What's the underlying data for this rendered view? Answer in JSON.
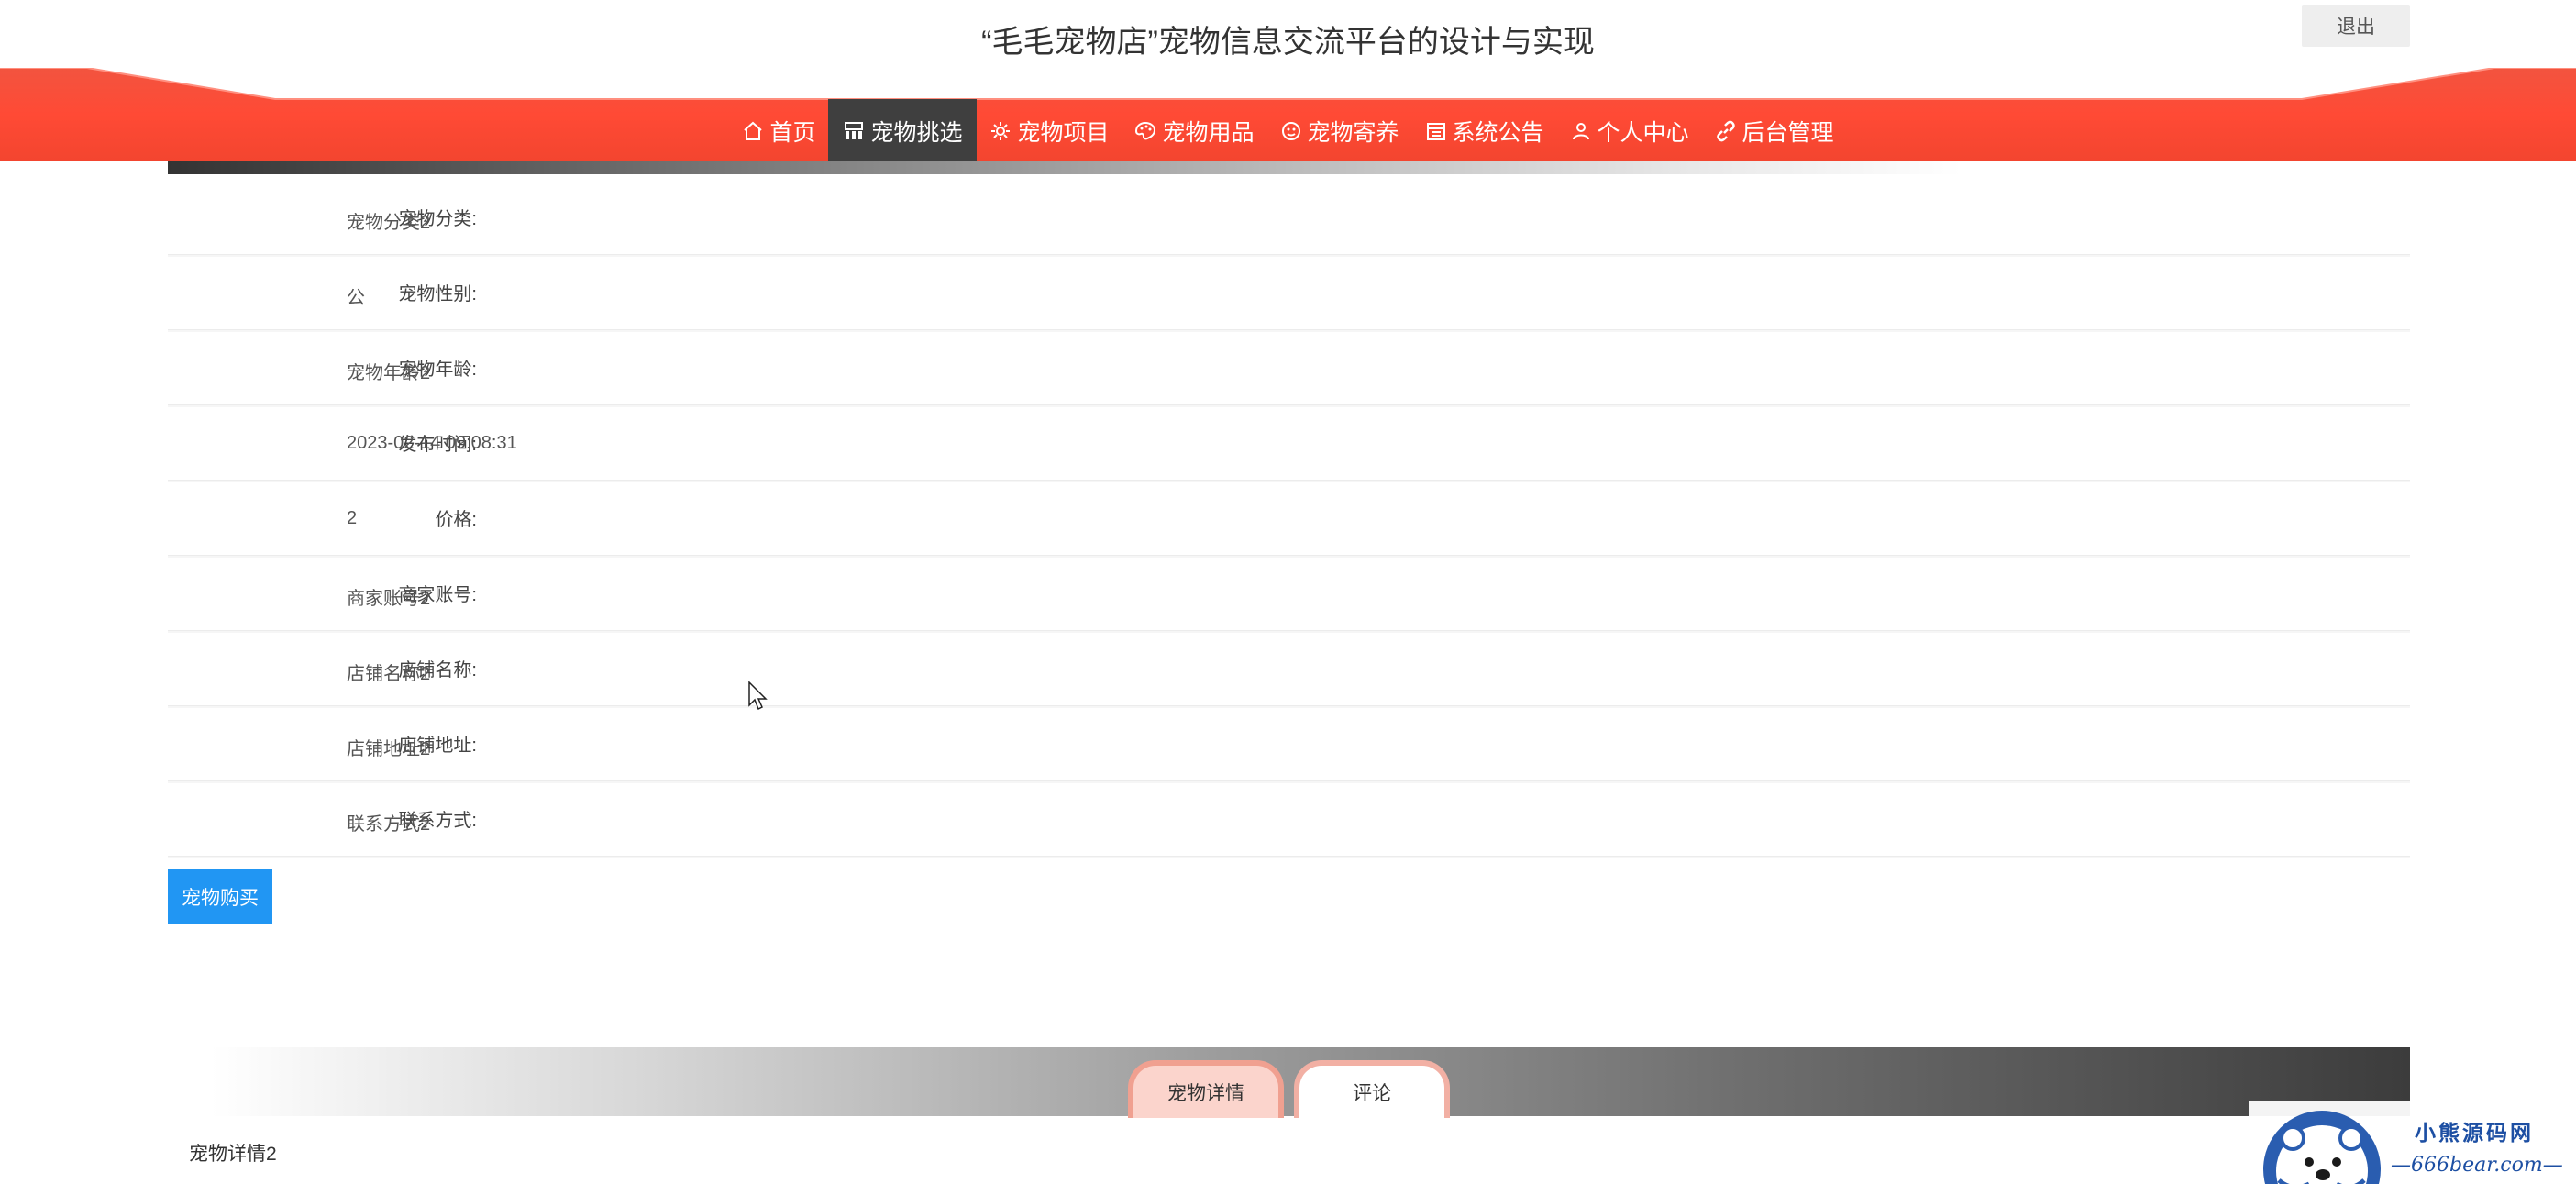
{
  "header": {
    "title": "“毛毛宠物店”宠物信息交流平台的设计与实现",
    "logout": "退出"
  },
  "nav": {
    "items": [
      {
        "label": "首页",
        "icon": "home-icon"
      },
      {
        "label": "宠物挑选",
        "icon": "grid-icon"
      },
      {
        "label": "宠物项目",
        "icon": "settings-icon"
      },
      {
        "label": "宠物用品",
        "icon": "palette-icon"
      },
      {
        "label": "宠物寄养",
        "icon": "paw-icon"
      },
      {
        "label": "系统公告",
        "icon": "calendar-icon"
      },
      {
        "label": "个人中心",
        "icon": "user-icon"
      },
      {
        "label": "后台管理",
        "icon": "link-icon"
      }
    ],
    "active_index": 1
  },
  "details": [
    {
      "label": "宠物分类:",
      "value": "宠物分类2"
    },
    {
      "label": "宠物性别:",
      "value": "公"
    },
    {
      "label": "宠物年龄:",
      "value": "宠物年龄2"
    },
    {
      "label": "发布时间:",
      "value": "2023-02-14 09:08:31"
    },
    {
      "label": "价格:",
      "value": "2"
    },
    {
      "label": "商家账号:",
      "value": "商家账号2"
    },
    {
      "label": "店铺名称:",
      "value": "店铺名称2"
    },
    {
      "label": "店铺地址:",
      "value": "店铺地址2"
    },
    {
      "label": "联系方式:",
      "value": "联系方式2"
    }
  ],
  "buy_button": "宠物购买",
  "tabs": [
    {
      "label": "宠物详情"
    },
    {
      "label": "评论"
    }
  ],
  "detail_content": "宠物详情2",
  "watermark": {
    "cn": "小熊源码网",
    "en": "—666bear.com—"
  },
  "colors": {
    "nav_red": "#f04a3a",
    "nav_active": "#3f3f3f",
    "button_blue": "#2196f3"
  }
}
